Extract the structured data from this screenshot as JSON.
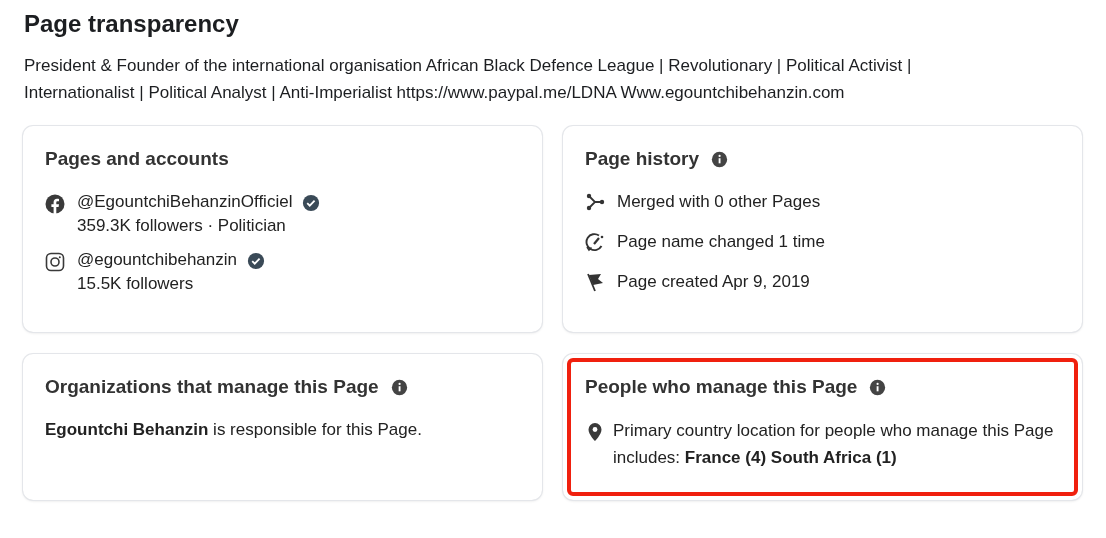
{
  "title": "Page transparency",
  "description": "President & Founder of the international organisation African Black Defence League | Revolutionary | Political Activist | Internationalist | Political Analyst | Anti-Imperialist https://www.paypal.me/LDNA Www.egountchibehanzin.com",
  "cards": [
    {
      "kind": "accounts",
      "title": "Pages and accounts",
      "info": false,
      "highlighted": false,
      "accounts": [
        {
          "handle": "@EgountchiBehanzinOfficiel",
          "verified": true,
          "detail": "359.3K followers · Politician"
        },
        {
          "handle": "@egountchibehanzin",
          "verified": true,
          "detail": "15.5K followers"
        }
      ]
    },
    {
      "kind": "history",
      "title": "Page history",
      "info": true,
      "highlighted": false,
      "items": [
        "Merged with 0 other Pages",
        "Page name changed 1 time",
        "Page created Apr 9, 2019"
      ]
    },
    {
      "kind": "text",
      "title": "Organizations that manage this Page",
      "info": true,
      "highlighted": false,
      "text": "**Egountchi Behanzin** is responsible for this Page."
    },
    {
      "kind": "location",
      "title": "People who manage this Page",
      "info": true,
      "highlighted": true,
      "text": "Primary country location for people who manage this Page includes: **France (4) South Africa (1)**"
    }
  ]
}
